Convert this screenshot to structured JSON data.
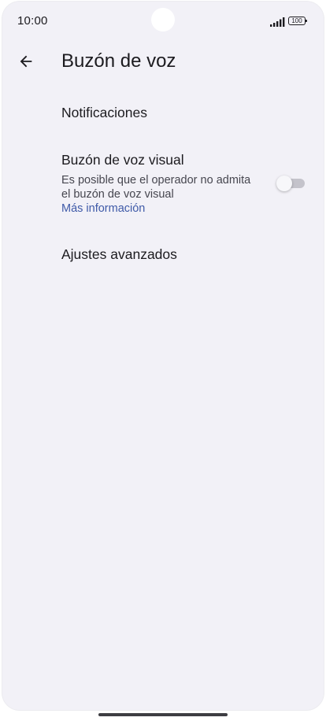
{
  "status_bar": {
    "time": "10:00",
    "battery": "100",
    "signal_icon": "signal-bars-icon"
  },
  "app_bar": {
    "back_icon": "arrow-back-icon",
    "title": "Buzón de voz"
  },
  "settings": {
    "notifications": {
      "label": "Notificaciones"
    },
    "visual_voicemail": {
      "label": "Buzón de voz visual",
      "description": "Es posible que el operador no admita el buzón de voz visual",
      "link": "Más información",
      "toggle_on": false
    },
    "advanced": {
      "label": "Ajustes avanzados"
    }
  },
  "colors": {
    "background": "#f2f1f7",
    "link": "#3f5aa8",
    "text": "#1c1b1f"
  }
}
